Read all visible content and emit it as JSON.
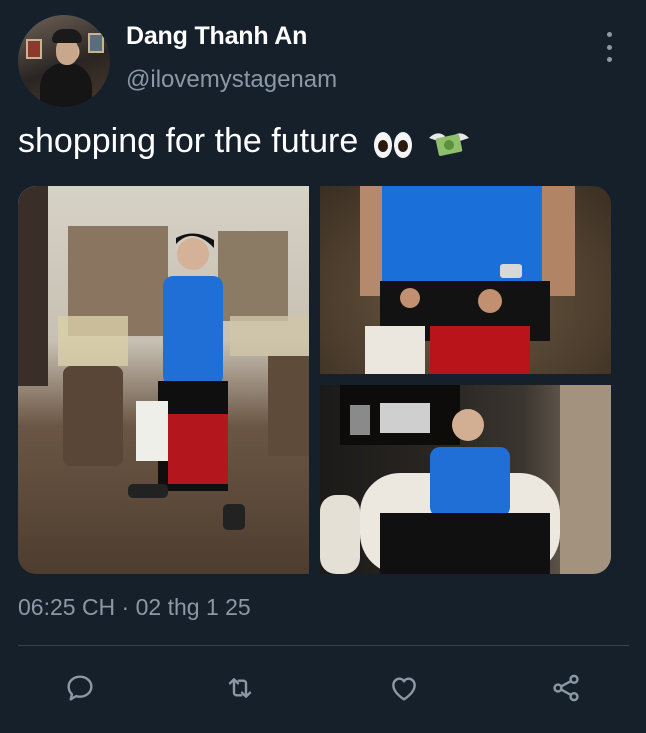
{
  "tweet": {
    "author_name": "Dang Thanh An",
    "author_handle": "@ilovemystagenam",
    "text": "shopping for the future",
    "emojis": [
      "eyes-emoji",
      "money-with-wings-emoji"
    ],
    "timestamp": "06:25 CH · 02 thg 1 25",
    "media": [
      {
        "icon": "photo-store-standing-shopping-bags"
      },
      {
        "icon": "photo-hands-holding-red-bag"
      },
      {
        "icon": "photo-seated-armchair"
      }
    ]
  },
  "actions": [
    {
      "name": "reply-icon"
    },
    {
      "name": "retweet-icon"
    },
    {
      "name": "like-icon"
    },
    {
      "name": "share-icon"
    }
  ],
  "colors": {
    "background": "#15202b",
    "secondary_text": "#8b98a5",
    "divider": "#38444d"
  }
}
